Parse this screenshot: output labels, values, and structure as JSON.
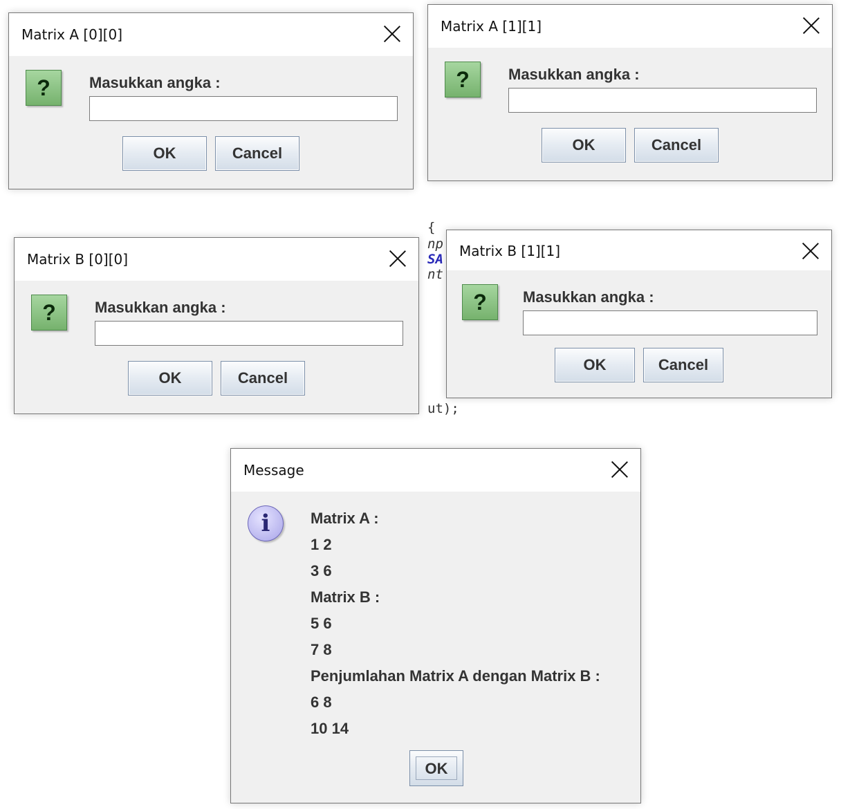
{
  "background_code": {
    "brace": "{",
    "line_np": "np",
    "line_sa": "SA",
    "line_nt": "nt",
    "line_ut": "ut);"
  },
  "dialogs": [
    {
      "title": "Matrix A [0][0]",
      "prompt": "Masukkan angka :",
      "input_value": "",
      "ok_label": "OK",
      "cancel_label": "Cancel"
    },
    {
      "title": "Matrix A [1][1]",
      "prompt": "Masukkan angka :",
      "input_value": "",
      "ok_label": "OK",
      "cancel_label": "Cancel"
    },
    {
      "title": "Matrix B [0][0]",
      "prompt": "Masukkan angka :",
      "input_value": "",
      "ok_label": "OK",
      "cancel_label": "Cancel"
    },
    {
      "title": "Matrix B [1][1]",
      "prompt": "Masukkan angka :",
      "input_value": "",
      "ok_label": "OK",
      "cancel_label": "Cancel"
    }
  ],
  "question_icon": "?",
  "message": {
    "title": "Message",
    "icon": "i",
    "lines": [
      "Matrix A :",
      "1 2",
      "3 6",
      "Matrix B :",
      "5 6",
      "7 8",
      "Penjumlahan Matrix A dengan Matrix B :",
      "6 8",
      "10 14"
    ],
    "ok_label": "OK"
  }
}
